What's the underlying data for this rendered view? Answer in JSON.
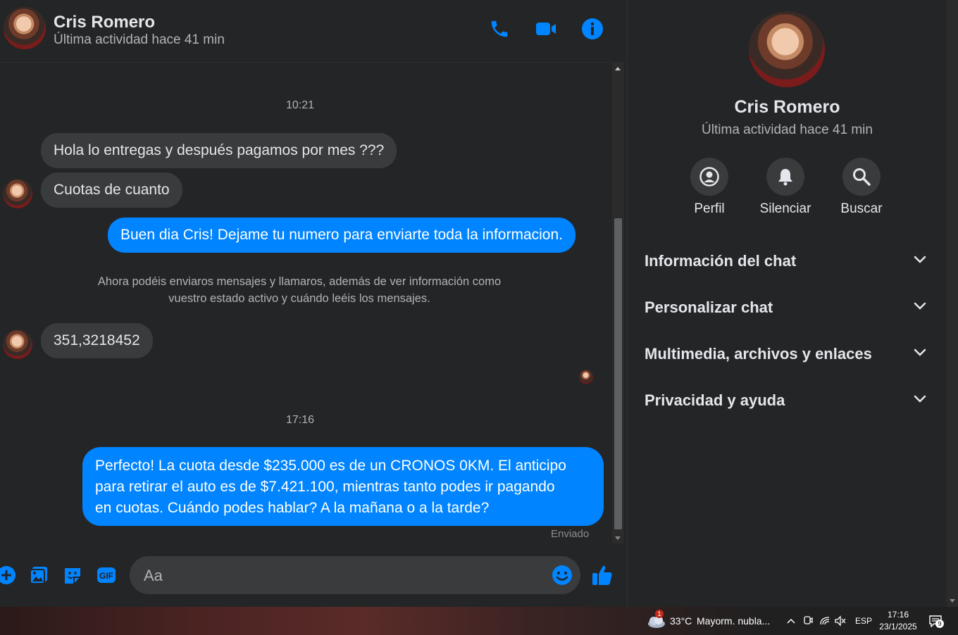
{
  "contact": {
    "name": "Cris Romero",
    "status": "Última actividad hace 41 min"
  },
  "header_actions": [
    {
      "icon": "phone-icon",
      "label": "Llamar"
    },
    {
      "icon": "video-camera-icon",
      "label": "Videollamada"
    },
    {
      "icon": "info-icon",
      "label": "Información"
    }
  ],
  "conversation": {
    "timestamp_1": "10:21",
    "msg_1": "Hola lo entregas y después pagamos por mes ???",
    "msg_2": "Cuotas de cuanto",
    "msg_3": "Buen dia Cris! Dejame tu numero para enviarte toda la informacion.",
    "system_note_line1": "Ahora podéis enviaros mensajes y llamaros, además de ver información como",
    "system_note_line2": "vuestro estado activo y cuándo leéis los mensajes.",
    "msg_4": "351,3218452",
    "timestamp_2": "17:16",
    "msg_5_line1": "Perfecto! La cuota desde $235.000 es de un CRONOS 0KM. El anticipo",
    "msg_5_line2": "para retirar el auto es de $7.421.100, mientras tanto podes ir pagando",
    "msg_5_line3": "en cuotas. Cuándo podes hablar? A la mañana o a la tarde?",
    "sent_status": "Enviado"
  },
  "composer": {
    "placeholder": "Aa",
    "icons": [
      "plus-icon",
      "photo-icon",
      "sticker-icon",
      "gif-icon",
      "emoji-icon",
      "thumbs-up-icon"
    ],
    "gif_label": "GIF"
  },
  "info_panel": {
    "name": "Cris Romero",
    "status": "Última actividad hace 41 min",
    "actions": [
      {
        "label": "Perfil",
        "icon": "profile-icon"
      },
      {
        "label": "Silenciar",
        "icon": "bell-icon"
      },
      {
        "label": "Buscar",
        "icon": "search-icon"
      }
    ],
    "sections": [
      "Información del chat",
      "Personalizar chat",
      "Multimedia, archivos y enlaces",
      "Privacidad y ayuda"
    ]
  },
  "taskbar": {
    "weather_temp": "33°C",
    "weather_desc": "Mayorm. nubla...",
    "weather_badge": "1",
    "language": "ESP",
    "time": "17:16",
    "date": "23/1/2025",
    "notification_count": "9"
  },
  "colors": {
    "accent": "#0084ff",
    "background": "#242526",
    "bubble_incoming": "#3a3b3c",
    "secondary_text": "#b0b3b8"
  }
}
